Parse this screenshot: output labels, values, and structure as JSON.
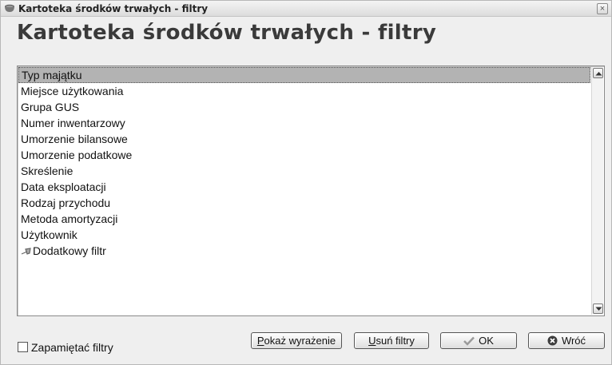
{
  "window": {
    "title": "Kartoteka środków trwałych - filtry",
    "close_glyph": "×",
    "app_icon": "cup-icon"
  },
  "heading": "Kartoteka środków trwałych - filtry",
  "filters": {
    "items": [
      {
        "label": "Typ majątku",
        "selected": true
      },
      {
        "label": "Miejsce użytkowania"
      },
      {
        "label": "Grupa GUS"
      },
      {
        "label": "Numer inwentarzowy"
      },
      {
        "label": "Umorzenie bilansowe"
      },
      {
        "label": "Umorzenie podatkowe"
      },
      {
        "label": "Skreślenie"
      },
      {
        "label": "Data eksploatacji"
      },
      {
        "label": "Rodzaj przychodu"
      },
      {
        "label": "Metoda amortyzacji"
      },
      {
        "label": "Użytkownik"
      },
      {
        "label": "Dodatkowy filtr",
        "icon": "pin-icon"
      }
    ]
  },
  "remember": {
    "label": "Zapamiętać filtry",
    "checked": false
  },
  "buttons": {
    "show_prefix": "P",
    "show_rest": "okaż wyrażenie",
    "remove_prefix": "U",
    "remove_rest": "suń filtry",
    "ok": "OK",
    "back": "Wróć"
  }
}
